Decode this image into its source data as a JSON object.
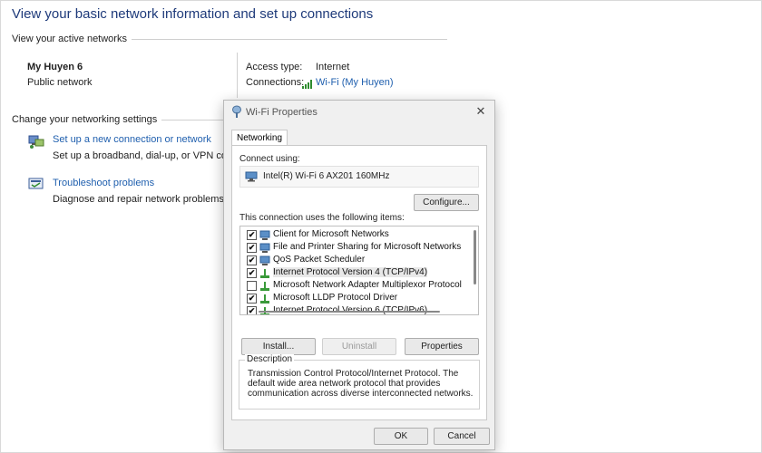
{
  "window": {
    "title": "View your basic network information and set up connections"
  },
  "active_networks": {
    "header": "View your active networks",
    "network_name": "My Huyen 6",
    "network_type": "Public network",
    "access_type_label": "Access type:",
    "access_type_value": "Internet",
    "connections_label": "Connections:",
    "connections_value": "Wi-Fi (My Huyen)"
  },
  "settings": {
    "header": "Change your networking settings",
    "items": [
      {
        "title": "Set up a new connection or network",
        "description": "Set up a broadband, dial-up, or VPN conne",
        "icon": "network-setup-icon"
      },
      {
        "title": "Troubleshoot problems",
        "description": "Diagnose and repair network problems, or",
        "icon": "troubleshoot-icon"
      }
    ]
  },
  "dialog": {
    "title": "Wi-Fi Properties",
    "close": "✕",
    "tab": "Networking",
    "connect_using_label": "Connect using:",
    "adapter_name": "Intel(R) Wi-Fi 6 AX201 160MHz",
    "configure_button": "Configure...",
    "items_label": "This connection uses the following items:",
    "items": [
      {
        "label": "Client for Microsoft Networks",
        "checked": true,
        "icon": "client-icon"
      },
      {
        "label": "File and Printer Sharing for Microsoft Networks",
        "checked": true,
        "icon": "sharing-icon"
      },
      {
        "label": "QoS Packet Scheduler",
        "checked": true,
        "icon": "qos-icon"
      },
      {
        "label": "Internet Protocol Version 4 (TCP/IPv4)",
        "checked": true,
        "icon": "protocol-icon",
        "selected": true
      },
      {
        "label": "Microsoft Network Adapter Multiplexor Protocol",
        "checked": false,
        "icon": "protocol-icon"
      },
      {
        "label": "Microsoft LLDP Protocol Driver",
        "checked": true,
        "icon": "protocol-icon"
      },
      {
        "label": "Internet Protocol Version 6 (TCP/IPv6)",
        "checked": true,
        "icon": "protocol-icon"
      }
    ],
    "install_button": "Install...",
    "uninstall_button": "Uninstall",
    "properties_button": "Properties",
    "description_title": "Description",
    "description_text": "Transmission Control Protocol/Internet Protocol. The default wide area network protocol that provides communication across diverse interconnected networks.",
    "ok_button": "OK",
    "cancel_button": "Cancel"
  },
  "colors": {
    "title": "#1e3a7a",
    "link": "#1f5fae"
  }
}
